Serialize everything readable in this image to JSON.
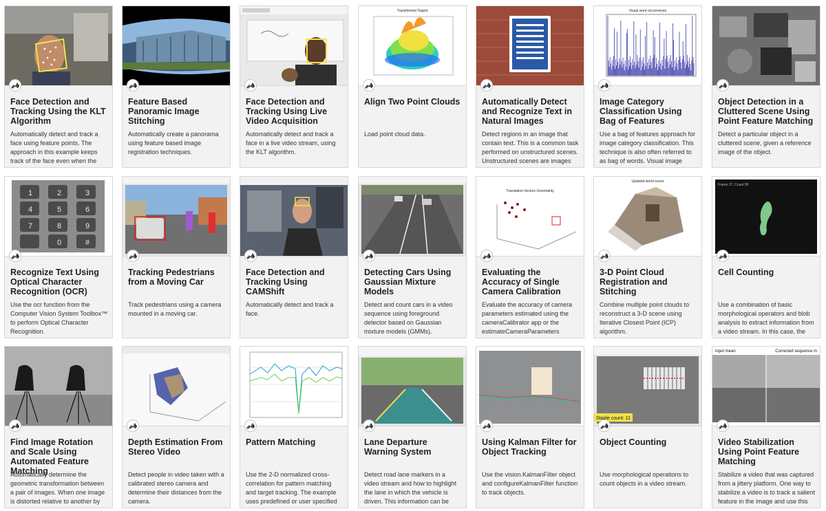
{
  "examples": [
    {
      "title": "Face Detection and Tracking Using the KLT Algorithm",
      "desc": "Automatically detect and track a face using feature points. The approach in this example keeps track of the face even when the person tilts his or",
      "thumb_icon": "face-tracking-thumbnail"
    },
    {
      "title": "Feature Based Panoramic Image Stitching",
      "desc": "Automatically create a panorama using feature based image registration techniques.",
      "thumb_icon": "panorama-thumbnail"
    },
    {
      "title": "Face Detection and Tracking Using Live Video Acquisition",
      "desc": "Automatically detect and track a face in a live video stream, using the KLT algorithm.",
      "thumb_icon": "live-video-thumbnail"
    },
    {
      "title": "Align Two Point Clouds",
      "desc": "Load point cloud data.",
      "thumb_label": "Transformed Teapot",
      "thumb_icon": "teapot-thumbnail"
    },
    {
      "title": "Automatically Detect and Recognize Text in Natural Images",
      "desc": "Detect regions in an image that contain text. This is a common task performed on unstructured scenes. Unstructured scenes are images that",
      "thumb_icon": "sign-thumbnail"
    },
    {
      "title": "Image Category Classification Using Bag of Features",
      "desc": "Use a bag of features approach for image category classification. This technique is also often referred to as bag of words. Visual image",
      "thumb_label": "Visual word occurrences",
      "thumb_icon": "histogram-thumbnail"
    },
    {
      "title": "Object Detection in a Cluttered Scene Using Point Feature Matching",
      "desc": "Detect a particular object in a cluttered scene, given a reference image of the object.",
      "thumb_icon": "cluttered-scene-thumbnail"
    },
    {
      "title": "Recognize Text Using Optical Character Recognition (OCR)",
      "desc": "Use the ocr function from the Computer Vision System Toolbox™ to perform Optical Character Recognition.",
      "thumb_icon": "keypad-thumbnail"
    },
    {
      "title": "Tracking Pedestrians from a Moving Car",
      "desc": "Track pedestrians using a camera mounted in a moving car.",
      "thumb_icon": "street-thumbnail"
    },
    {
      "title": "Face Detection and Tracking Using CAMShift",
      "desc": "Automatically detect and track a face.",
      "thumb_icon": "camshift-thumbnail"
    },
    {
      "title": "Detecting Cars Using Gaussian Mixture Models",
      "desc": "Detect and count cars in a video sequence using foreground detector based on Gaussian mixture models (GMMs).",
      "thumb_icon": "highway-thumbnail"
    },
    {
      "title": "Evaluating the Accuracy of Single Camera Calibration",
      "desc": "Evaluate the accuracy of camera parameters estimated using the cameraCalibrator app or the estimateCameraParameters",
      "thumb_label": "Translation Vectors Uncertainty",
      "thumb_icon": "calibration-plot-thumbnail"
    },
    {
      "title": "3-D Point Cloud Registration and Stitching",
      "desc": "Combine multiple point clouds to reconstruct a 3-D scene using Iterative Closest Point (ICP) algorithm.",
      "thumb_label": "Updated world scene",
      "thumb_icon": "point-cloud-scene-thumbnail"
    },
    {
      "title": "Cell Counting",
      "desc": "Use a combination of basic morphological operators and blob analysis to extract information from a video stream. In this case, the",
      "thumb_label": "Frame 27, Count 95",
      "thumb_icon": "cells-thumbnail"
    },
    {
      "title": "Find Image Rotation and Scale Using Automated Feature Matching",
      "desc": "Automatically determine the geometric transformation between a pair of images. When one image is distorted relative to another by",
      "thumb_icon": "cameraman-thumbnail"
    },
    {
      "title": "Depth Estimation From Stereo Video",
      "desc": "Detect people in video taken with a calibrated stereo camera and determine their distances from the camera.",
      "thumb_icon": "depth-thumbnail"
    },
    {
      "title": "Pattern Matching",
      "desc": "Use the 2-D normalized cross-correlation for pattern matching and target tracking. The example uses predefined or user specified target",
      "thumb_icon": "pattern-plot-thumbnail"
    },
    {
      "title": "Lane Departure Warning System",
      "desc": "Detect road lane markers in a video stream and how to highlight the lane in which the vehicle is driven. This information can be used to detect an",
      "thumb_icon": "lane-thumbnail"
    },
    {
      "title": "Using Kalman Filter for Object Tracking",
      "desc": "Use the vision.KalmanFilter object and configureKalmanFilter function to track objects.",
      "thumb_icon": "kalman-thumbnail"
    },
    {
      "title": "Object Counting",
      "desc": "Use morphological operations to count objects in a video stream.",
      "thumb_label": "Staple count: 11",
      "thumb_icon": "staples-thumbnail"
    },
    {
      "title": "Video Stabilization Using Point Feature Matching",
      "desc": "Stabilize a video that was captured from a jittery platform. One way to stabilize a video is to track a salient feature in the image and use this as",
      "thumb_label": "input mean",
      "thumb_label_2": "Corrected sequence m",
      "thumb_icon": "stabilization-thumbnail"
    }
  ],
  "colors": {
    "card_bg": "#f2f2f2",
    "border": "#d6d6d6",
    "title": "#222222",
    "text": "#333333"
  },
  "badge_icon": "matlab-logo-icon"
}
